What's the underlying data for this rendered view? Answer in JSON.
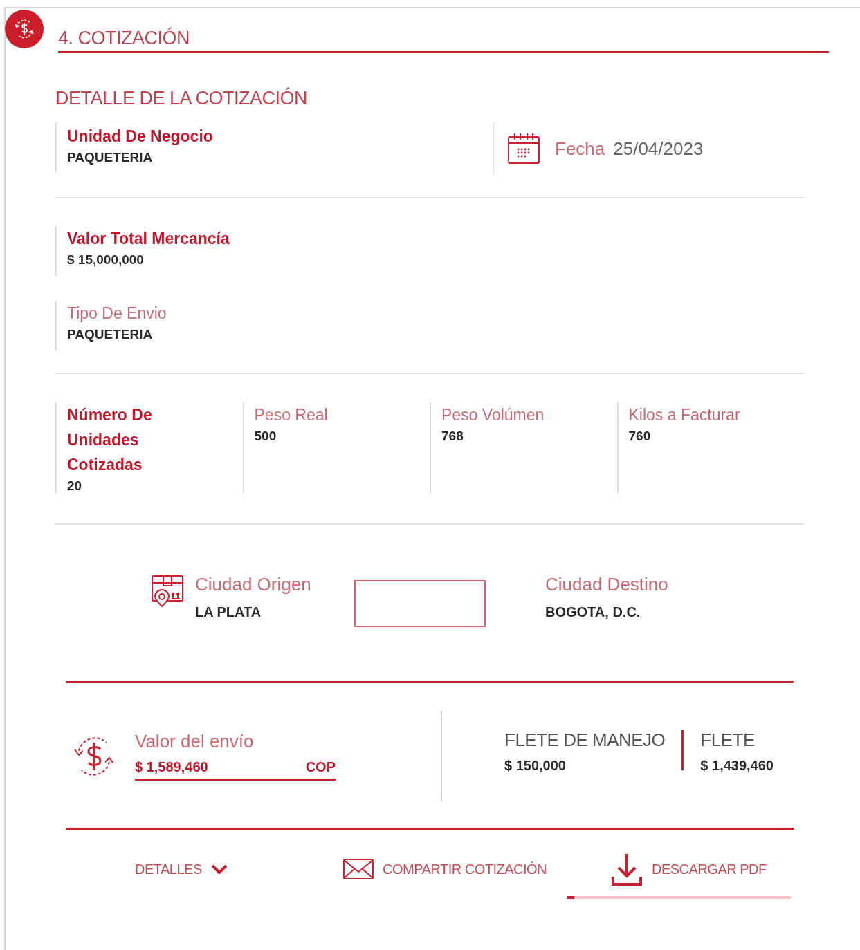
{
  "header": {
    "title": "4. COTIZACIÓN"
  },
  "section_title": "DETALLE DE LA COTIZACIÓN",
  "business_unit": {
    "label": "Unidad De Negocio",
    "value": "PAQUETERIA",
    "emphasis": true
  },
  "date": {
    "label": "Fecha",
    "value": "25/04/2023"
  },
  "fields": [
    {
      "label": "Valor Total Mercancía",
      "value": "$ 15,000,000",
      "emphasis": true
    },
    {
      "label": "Tipo De Envio",
      "value": "PAQUETERIA",
      "emphasis": false
    }
  ],
  "measures": [
    {
      "label": "Número De Unidades Cotizadas",
      "value": "20",
      "emphasis": true
    },
    {
      "label": "Peso Real",
      "value": "500",
      "emphasis": false
    },
    {
      "label": "Peso Volúmen",
      "value": "768",
      "emphasis": false
    },
    {
      "label": "Kilos a Facturar",
      "value": "760",
      "emphasis": false
    }
  ],
  "route": {
    "origin": {
      "label": "Ciudad Origen",
      "value": "LA PLATA"
    },
    "destination": {
      "label": "Ciudad Destino",
      "value": "BOGOTA, D.C."
    }
  },
  "shipping_value": {
    "label": "Valor del envío",
    "amount": "$ 1,589,460",
    "currency": "COP"
  },
  "charges": [
    {
      "label": "FLETE DE MANEJO",
      "value": "$ 150,000"
    },
    {
      "label": "FLETE",
      "value": "$ 1,439,460"
    }
  ],
  "actions": [
    {
      "kind": "details",
      "label": "DETALLES"
    },
    {
      "kind": "share",
      "label": "COMPARTIR COTIZACIÓN"
    },
    {
      "kind": "download",
      "label": "DESCARGAR PDF",
      "level": 0.03
    }
  ]
}
